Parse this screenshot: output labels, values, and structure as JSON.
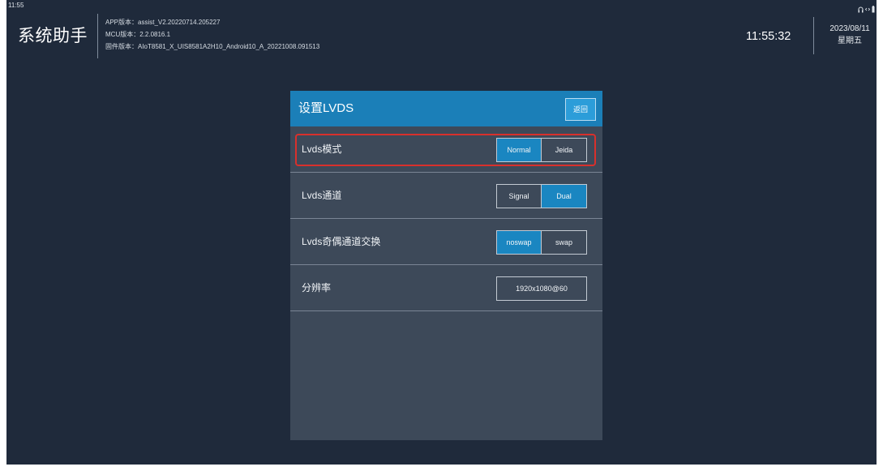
{
  "status_bar": {
    "time": "11:55",
    "icons": [
      "headphones-icon",
      "arrows-icon",
      "battery-icon"
    ]
  },
  "header": {
    "app_title": "系统助手",
    "versions": [
      {
        "label": "APP版本：",
        "value": "assist_V2.20220714.205227"
      },
      {
        "label": "MCU版本：",
        "value": "2.2.0816.1"
      },
      {
        "label": "固件版本：",
        "value": "AIoT8581_X_UIS8581A2H10_Android10_A_20221008.091513"
      }
    ],
    "clock": "11:55:32",
    "date": "2023/08/11",
    "weekday": "星期五"
  },
  "dialog": {
    "title": "设置LVDS",
    "back_label": "返回",
    "rows": [
      {
        "label": "Lvds模式",
        "options": [
          "Normal",
          "Jeida"
        ],
        "selected": 0,
        "highlighted": true
      },
      {
        "label": "Lvds通道",
        "options": [
          "Signal",
          "Dual"
        ],
        "selected": 1,
        "highlighted": false
      },
      {
        "label": "Lvds奇偶通道交换",
        "options": [
          "noswap",
          "swap"
        ],
        "selected": 0,
        "highlighted": false
      },
      {
        "label": "分辨率",
        "value": "1920x1080@60",
        "highlighted": false
      }
    ]
  },
  "colors": {
    "screen_background": "#1f2a3b",
    "panel_background": "#3d4959",
    "header_bar": "#1b7fb8",
    "selected_segment": "#1a86c1",
    "highlight_outline": "#d8302c"
  }
}
